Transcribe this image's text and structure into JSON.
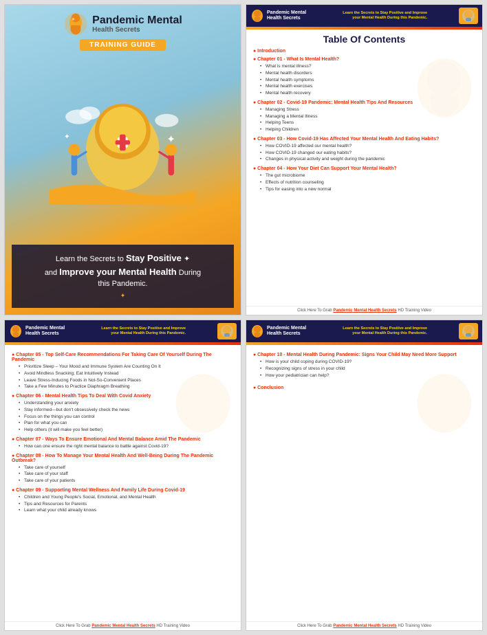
{
  "panels": {
    "cover": {
      "logo_text_main": "Pandemic Mental",
      "logo_text_sub": "Health Secrets",
      "badge": "TRAINING GUIDE",
      "tagline_line1": "Learn the Secrets to",
      "tagline_stay": "Stay Positive",
      "tagline_line2": "and",
      "tagline_improve": "Improve your Mental Health",
      "tagline_line3": "During this Pandemic."
    },
    "toc1": {
      "header_logo_line1": "Pandemic Mental",
      "header_logo_line2": "Health Secrets",
      "header_tagline": "Learn the Secrets to Stay Positive and Improve your Mental Health During this Pandemic.",
      "main_title": "Table Of Contents",
      "chapters": [
        {
          "title": "Introduction",
          "bullets": []
        },
        {
          "title": "Chapter 01 - What Is Mental Health?",
          "bullets": [
            "What is mental illness?",
            "Mental health disorders",
            "Mental health symptoms",
            "Mental health exercises",
            "Mental health recovery"
          ]
        },
        {
          "title": "Chapter 02 - Covid-19 Pandemic: Mental Health Tips And Resources",
          "bullets": [
            "Managing Stress",
            "Managing a Mental Illness",
            "Helping Teens",
            "Helping Children"
          ]
        },
        {
          "title": "Chapter 03 - How Covid-19 Has Affected Your Mental Health And Eating Habits?",
          "bullets": [
            "How COVID-19 affected our mental health?",
            "How COVID-19 changed our eating habits?",
            "Changes in physical activity and weight during the pandemic"
          ]
        },
        {
          "title": "Chapter 04 - How Your Diet Can Support Your Mental Health?",
          "bullets": [
            "The gut microbiome",
            "Effects of nutrition counseling",
            "Tips for easing into a new normal"
          ]
        }
      ],
      "footer": "Click Here To Grab Pandemic Mental Health Secrets HD Training Video"
    },
    "toc2": {
      "header_logo_line1": "Pandemic Mental",
      "header_logo_line2": "Health Secrets",
      "header_tagline": "Learn the Secrets to Stay Positive and Improve your Mental Health During this Pandemic.",
      "chapters": [
        {
          "title": "Chapter 05 - Top Self-Care Recommendations For Taking Care Of Yourself During The Pandemic",
          "bullets": [
            "Prioritize Sleep – Your Mood and Immune System Are Counting On It",
            "Avoid Mindless Snacking; Eat Intuitively Instead",
            "Leave Stress-Inducing Foods in Not-So-Convenient Places",
            "Take a Few Minutes to Practice Diaphragm Breathing"
          ]
        },
        {
          "title": "Chapter 06 - Mental Health Tips To Deal With Covid Anxiety",
          "bullets": [
            "Understanding your anxiety",
            "Stay informed—but don't obsessively check the news",
            "Focus on the things you can control",
            "Plan for what you can",
            "Help others (it will make you feel better)"
          ]
        },
        {
          "title": "Chapter 07 - Ways To Ensure Emotional And Mental Balance Amid The Pandemic",
          "bullets": [
            "How can one ensure the right mental balance to battle against Covid-19?"
          ]
        },
        {
          "title": "Chapter 08 - How To Manage Your Mental Health And Well-Being During The Pandemic Outbreak?",
          "bullets": [
            "Take care of yourself",
            "Take care of your staff",
            "Take care of your patients"
          ]
        },
        {
          "title": "Chapter 09 - Supporting Mental Wellness And Family Life During Covid-19",
          "bullets": [
            "Children and Young People's Social, Emotional, and Mental Health",
            "Tips and Resources for Parents",
            "Learn what your child already knows"
          ]
        }
      ],
      "footer": "Click Here To Grab Pandemic Mental Health Secrets HD Training Video"
    },
    "toc3": {
      "header_logo_line1": "Pandemic Mental",
      "header_logo_line2": "Health Secrets",
      "header_tagline": "Learn the Secrets to Stay Positive and Improve your Mental Health During this Pandemic.",
      "chapters": [
        {
          "title": "Chapter 10 - Mental Health During Pandemic: Signs Your Child May Need More Support",
          "bullets": [
            "How is your child coping during COVID-19?",
            "Recognizing signs of stress in your child",
            "How your pediatrician can help?"
          ]
        },
        {
          "title": "Conclusion",
          "bullets": []
        }
      ],
      "footer": "Click Here To Grab Pandemic Mental Health Secrets HD Training Video"
    }
  }
}
